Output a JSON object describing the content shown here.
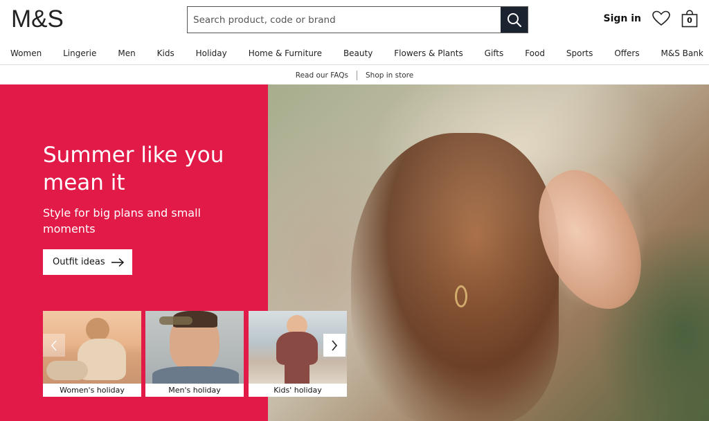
{
  "header": {
    "logo": "M&S",
    "search_placeholder": "Search product, code or brand",
    "sign_in": "Sign in",
    "bag_count": "0"
  },
  "nav": {
    "items": [
      "Women",
      "Lingerie",
      "Men",
      "Kids",
      "Holiday",
      "Home & Furniture",
      "Beauty",
      "Flowers & Plants",
      "Gifts",
      "Food",
      "Sports",
      "Offers",
      "M&S Bank"
    ]
  },
  "utility": {
    "faqs": "Read our FAQs",
    "shop_in_store": "Shop in store"
  },
  "hero": {
    "title": "Summer like you mean it",
    "subtitle": "Style for big plans and small moments",
    "cta": "Outfit ideas",
    "panel_color": "#e21a48"
  },
  "carousel": {
    "cards": [
      {
        "label": "Women's holiday"
      },
      {
        "label": "Men's holiday"
      },
      {
        "label": "Kids' holiday"
      }
    ]
  },
  "icons": {
    "search": "search-icon",
    "wishlist": "heart-icon",
    "bag": "shopping-bag-icon",
    "cta_arrow": "arrow-right-icon",
    "prev": "chevron-left-icon",
    "next": "chevron-right-icon"
  }
}
